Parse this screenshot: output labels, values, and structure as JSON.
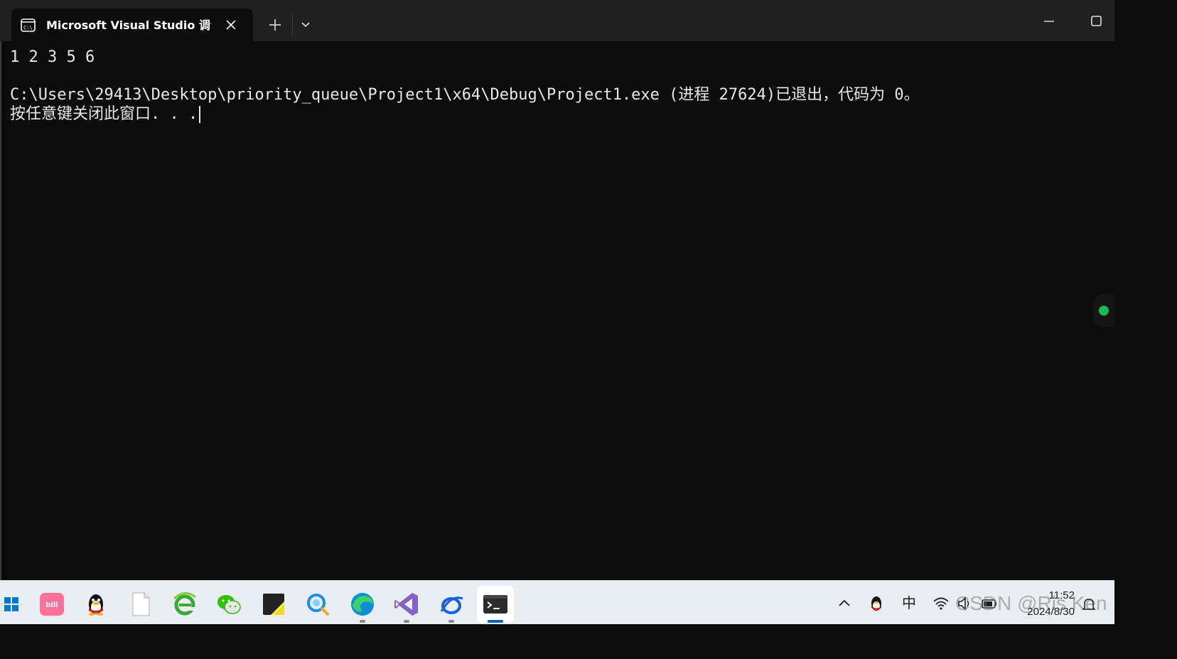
{
  "window": {
    "tab_title": "Microsoft Visual Studio 调试控",
    "tab_icon": "console-icon"
  },
  "console": {
    "line1": "1 2 3 5 6",
    "line2": "C:\\Users\\29413\\Desktop\\priority_queue\\Project1\\x64\\Debug\\Project1.exe (进程 27624)已退出，代码为 0。",
    "line3": "按任意键关闭此窗口. . ."
  },
  "taskbar": {
    "apps": [
      "start-icon",
      "bilibili-icon",
      "qq-icon",
      "file-icon",
      "ie-icon",
      "wechat-icon",
      "sticky-notes-icon",
      "search-app-icon",
      "edge-icon",
      "visual-studio-icon",
      "browser-icon",
      "terminal-icon"
    ],
    "ime": "中",
    "time": "11:52",
    "date": "2024/8/30",
    "watermark": "CSDN @Ris Ken"
  },
  "colors": {
    "console_bg": "#0c0c0c",
    "titlebar_bg": "#202020",
    "taskbar_bg": "#e9eef3",
    "accent": "#0067c0",
    "status_dot": "#1db954"
  }
}
